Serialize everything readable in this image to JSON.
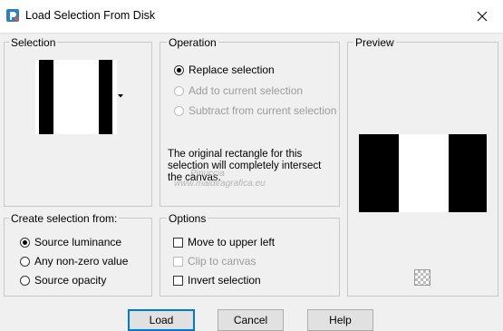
{
  "window": {
    "title": "Load Selection From Disk",
    "app_icon": "paintshop-icon",
    "close_icon": "close-icon"
  },
  "selection_group": {
    "title": "Selection",
    "dropdown_icon": "dropdown-arrow-icon"
  },
  "operation_group": {
    "title": "Operation",
    "options": [
      {
        "label": "Replace selection",
        "checked": true,
        "enabled": true
      },
      {
        "label": "Add to current selection",
        "checked": false,
        "enabled": false
      },
      {
        "label": "Subtract from current selection",
        "checked": false,
        "enabled": false
      }
    ],
    "info_text": "The original rectangle for this selection will completely intersect the canvas."
  },
  "preview_group": {
    "title": "Preview",
    "checker_icon": "transparency-checker-icon"
  },
  "create_from_group": {
    "title": "Create selection from:",
    "options": [
      {
        "label": "Source luminance",
        "checked": true
      },
      {
        "label": "Any non-zero value",
        "checked": false
      },
      {
        "label": "Source opacity",
        "checked": false
      }
    ]
  },
  "options_group": {
    "title": "Options",
    "items": [
      {
        "label": "Move to upper left",
        "checked": false,
        "enabled": true
      },
      {
        "label": "Clip to canvas",
        "checked": false,
        "enabled": false
      },
      {
        "label": "Invert selection",
        "checked": false,
        "enabled": true
      }
    ]
  },
  "buttons": {
    "load": "Load",
    "cancel": "Cancel",
    "help": "Help"
  },
  "watermark": {
    "line1": "Pinuccia",
    "line2": "www.maldiragrafica.eu"
  },
  "colors": {
    "accent": "#0078d7",
    "window_bg": "#f0f0f0",
    "group_border": "#c8c8c8"
  }
}
